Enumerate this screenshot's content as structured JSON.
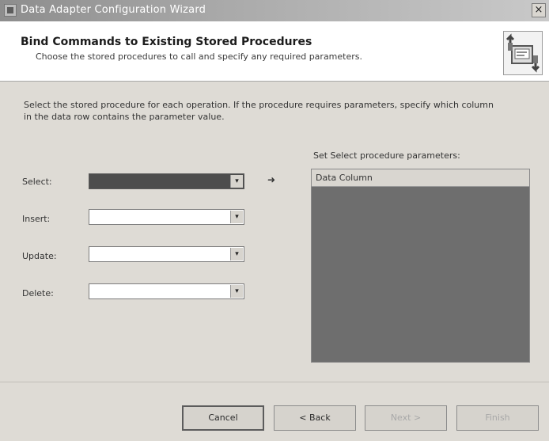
{
  "window": {
    "title": "Data Adapter Configuration Wizard",
    "close_glyph": "×"
  },
  "header": {
    "title": "Bind Commands to Existing Stored Procedures",
    "subtitle": "Choose the stored procedures to call and specify any required parameters.",
    "icon": "wizard-database-icon"
  },
  "main": {
    "instructions": "Select the stored procedure for each operation. If the procedure requires parameters, specify which column in the data row contains the parameter value.",
    "operations": [
      {
        "label": "Select:",
        "value": "",
        "selected": true
      },
      {
        "label": "Insert:",
        "value": "",
        "selected": false
      },
      {
        "label": "Update:",
        "value": "",
        "selected": false
      },
      {
        "label": "Delete:",
        "value": "",
        "selected": false
      }
    ],
    "arrow_glyph": "➜",
    "dropdown_glyph": "▾",
    "params_label": "Set Select procedure parameters:",
    "params_column_header": "Data Column"
  },
  "buttons": {
    "cancel": "Cancel",
    "back": "< Back",
    "next": "Next >",
    "finish": "Finish"
  },
  "colors": {
    "window_bg": "#dedbd5",
    "header_bg": "#ffffff",
    "selected_combo": "#4d4d4d",
    "grid_bg": "#6e6e6e",
    "disabled_text": "#a8a8a8"
  }
}
